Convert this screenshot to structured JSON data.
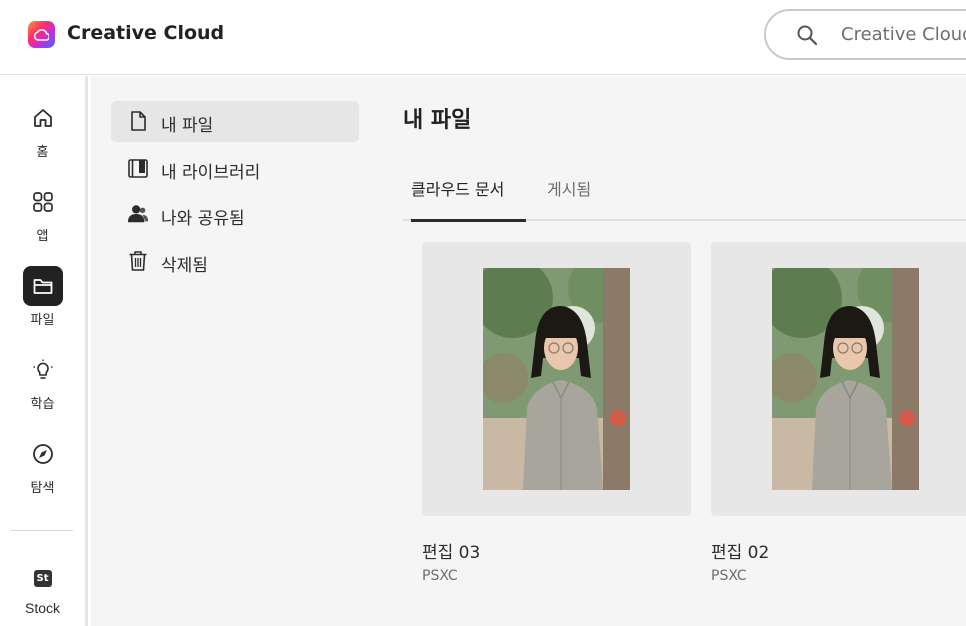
{
  "header": {
    "app_title": "Creative Cloud",
    "search_placeholder": "Creative Cloud"
  },
  "rail": {
    "items": [
      {
        "label": "홈",
        "icon": "home-icon"
      },
      {
        "label": "앱",
        "icon": "apps-grid-icon"
      },
      {
        "label": "파일",
        "icon": "folder-icon",
        "active": true
      },
      {
        "label": "학습",
        "icon": "lightbulb-icon"
      },
      {
        "label": "탐색",
        "icon": "compass-icon"
      }
    ],
    "stock": {
      "badge": "St",
      "label": "Stock"
    }
  },
  "subnav": {
    "items": [
      {
        "label": "내 파일",
        "icon": "file-icon",
        "active": true
      },
      {
        "label": "내 라이브러리",
        "icon": "library-icon"
      },
      {
        "label": "나와 공유됨",
        "icon": "shared-users-icon"
      },
      {
        "label": "삭제됨",
        "icon": "trash-icon"
      }
    ]
  },
  "main": {
    "title": "내 파일",
    "tabs": [
      {
        "label": "클라우드 문서",
        "active": true
      },
      {
        "label": "게시됨"
      }
    ],
    "files": [
      {
        "name": "편집 03",
        "type": "PSXC"
      },
      {
        "name": "편집 02",
        "type": "PSXC"
      }
    ]
  },
  "colors": {
    "active_rail_bg": "#222222",
    "panel_bg": "#f5f5f5",
    "card_bg": "#e7e7e7"
  }
}
